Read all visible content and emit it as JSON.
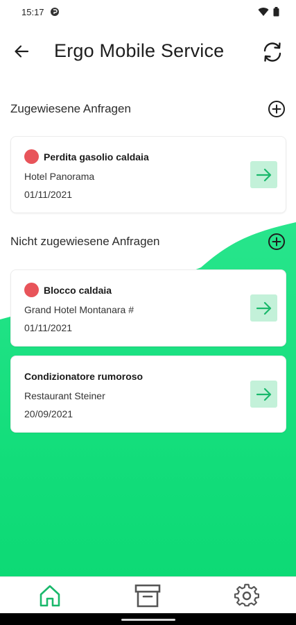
{
  "status_bar": {
    "time": "15:17"
  },
  "app_bar": {
    "title": "Ergo Mobile Service"
  },
  "assigned": {
    "heading": "Zugewiesene Anfragen",
    "cards": [
      {
        "title": "Perdita gasolio caldaia",
        "location": "Hotel Panorama",
        "date": "01/11/2021",
        "urgent": true
      }
    ]
  },
  "unassigned": {
    "heading": "Nicht zugewiesene Anfragen",
    "cards": [
      {
        "title": "Blocco caldaia",
        "location": "Grand Hotel Montanara #",
        "date": "01/11/2021",
        "urgent": true
      },
      {
        "title": "Condizionatore rumoroso",
        "location": "Restaurant Steiner",
        "date": "20/09/2021",
        "urgent": false
      }
    ]
  },
  "bottom_nav": {
    "items": [
      {
        "icon": "home-icon",
        "active": true
      },
      {
        "icon": "archive-icon",
        "active": false
      },
      {
        "icon": "gear-icon",
        "active": false
      }
    ]
  },
  "colors": {
    "accent": "#1cdc7e",
    "active_icon": "#19b86b",
    "urgent": "#e8545a",
    "go_button": "#c3f1d9"
  }
}
